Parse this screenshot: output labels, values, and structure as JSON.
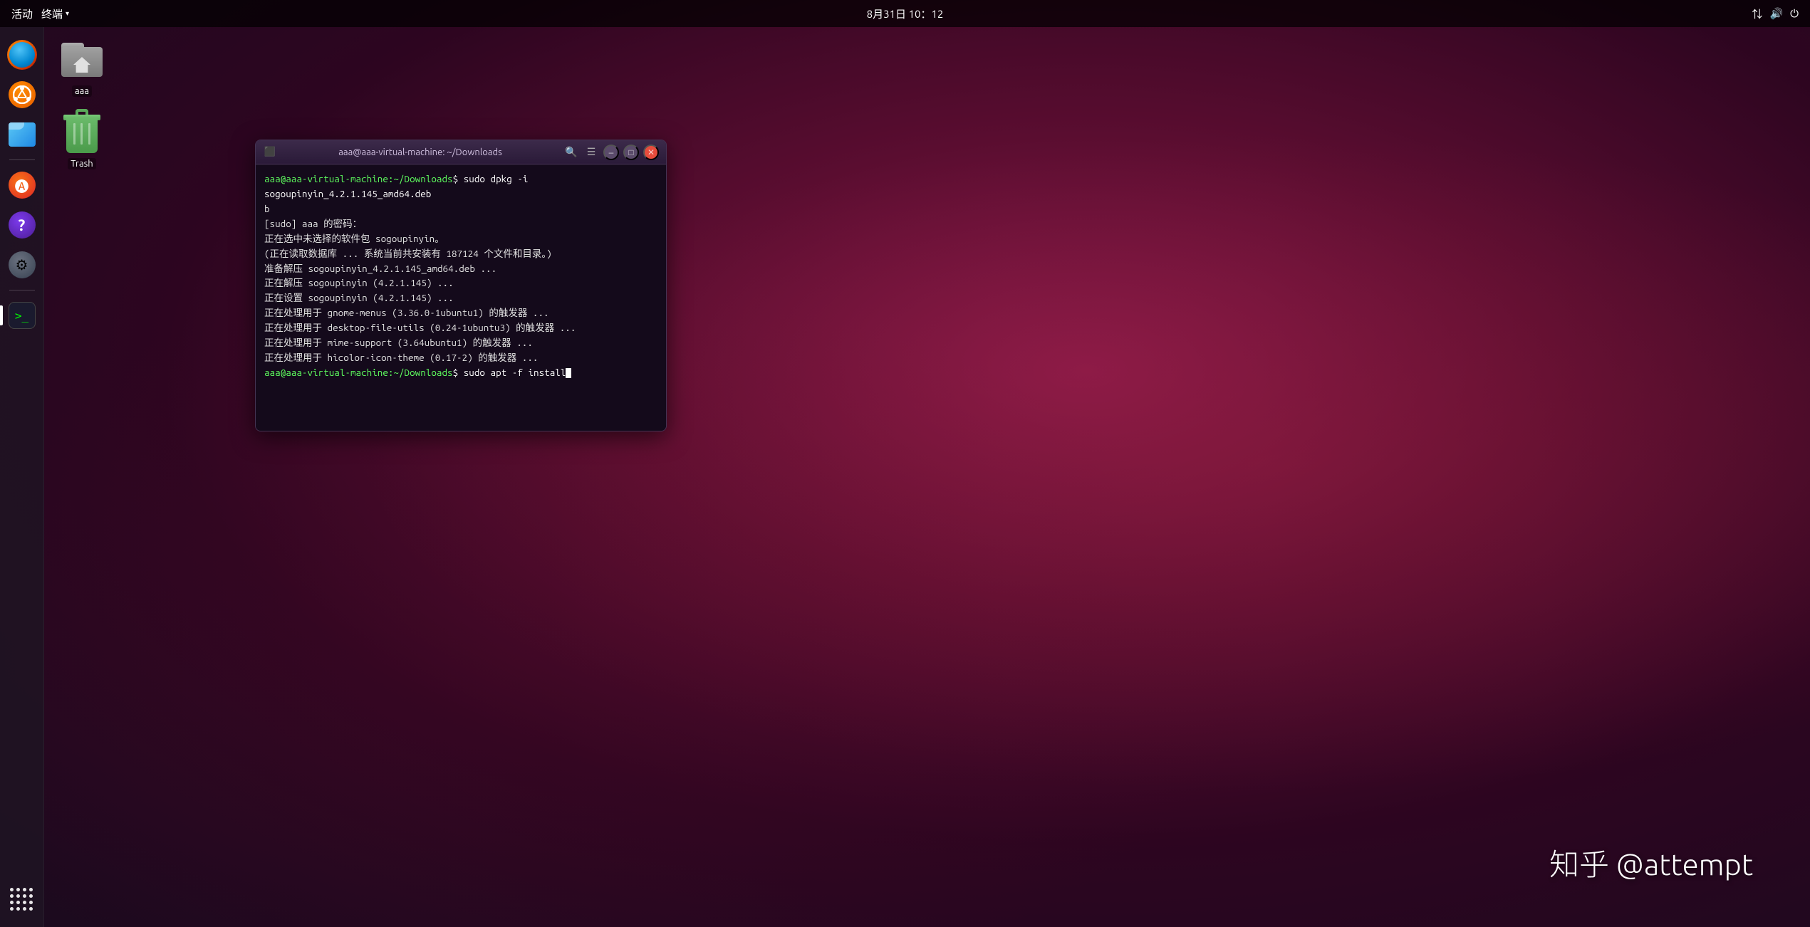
{
  "topbar": {
    "activities": "活动",
    "terminal_menu": "终端",
    "datetime": "8月31日 10：12"
  },
  "dock": {
    "items": [
      {
        "name": "firefox",
        "label": "Firefox"
      },
      {
        "name": "ubuntu",
        "label": "Ubuntu"
      },
      {
        "name": "files",
        "label": "Files"
      },
      {
        "name": "software-center",
        "label": "Software Center"
      },
      {
        "name": "help",
        "label": "Help"
      },
      {
        "name": "settings",
        "label": "Settings"
      },
      {
        "name": "terminal",
        "label": "Terminal"
      }
    ],
    "bottom": {
      "show_apps": "Show Applications"
    }
  },
  "desktop": {
    "icons": [
      {
        "id": "home",
        "label": "aaa"
      },
      {
        "id": "trash",
        "label": "Trash"
      }
    ]
  },
  "terminal": {
    "title": "aaa@aaa-virtual-machine: ~/Downloads",
    "lines": [
      {
        "type": "command",
        "prompt": "aaa@aaa-virtual-machine:~/Downloads",
        "cmd": "$ sudo dpkg -i sogoupinyin_4.2.1.145_amd64.deb"
      },
      {
        "type": "output",
        "text": "b"
      },
      {
        "type": "output",
        "text": "[sudo] aaa 的密码："
      },
      {
        "type": "output",
        "text": "正在选中未选择的软件包 sogoupinyin。"
      },
      {
        "type": "output",
        "text": "(正在读取数据库 ... 系统当前共安装有 187124 个文件和目录。)"
      },
      {
        "type": "output",
        "text": "准备解压 sogoupinyin_4.2.1.145_amd64.deb ..."
      },
      {
        "type": "output",
        "text": "正在解压 sogoupinyin (4.2.1.145) ..."
      },
      {
        "type": "output",
        "text": "正在设置 sogoupinyin (4.2.1.145) ..."
      },
      {
        "type": "output",
        "text": "正在处理用于 gnome-menus (3.36.0-1ubuntu1) 的触发器 ..."
      },
      {
        "type": "output",
        "text": "正在处理用于 desktop-file-utils (0.24-1ubuntu3) 的触发器 ..."
      },
      {
        "type": "output",
        "text": "正在处理用于 mime-support (3.64ubuntu1) 的触发器 ..."
      },
      {
        "type": "output",
        "text": "正在处理用于 hicolor-icon-theme (0.17-2) 的触发器 ..."
      },
      {
        "type": "command_cursor",
        "prompt": "aaa@aaa-virtual-machine:~/Downloads",
        "cmd": "$ sudo apt -f install"
      }
    ]
  },
  "watermark": {
    "text": "知乎 @attempt"
  }
}
